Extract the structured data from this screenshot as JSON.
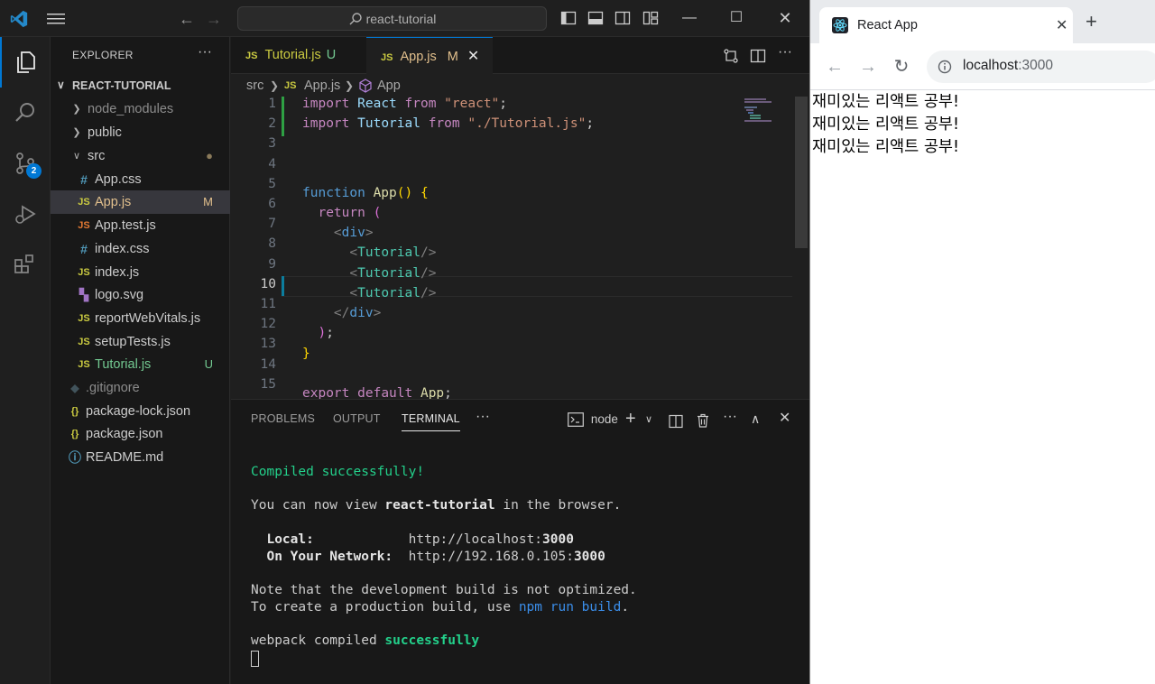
{
  "vscode": {
    "search": {
      "text": "react-tutorial"
    },
    "explorer": {
      "title": "EXPLORER",
      "more": "···",
      "project": "REACT-TUTORIAL",
      "items": [
        {
          "label": "node_modules",
          "kind": "folder",
          "icon": "chevron-right-icon",
          "status": ""
        },
        {
          "label": "public",
          "kind": "folder",
          "icon": "chevron-right-icon",
          "status": ""
        },
        {
          "label": "src",
          "kind": "folder-open",
          "icon": "chevron-down-icon",
          "status": "●"
        },
        {
          "label": "App.css",
          "kind": "file",
          "icon": "#",
          "status": ""
        },
        {
          "label": "App.js",
          "kind": "file",
          "icon": "JS",
          "status": "M"
        },
        {
          "label": "App.test.js",
          "kind": "file",
          "icon": "JS",
          "status": ""
        },
        {
          "label": "index.css",
          "kind": "file",
          "icon": "#",
          "status": ""
        },
        {
          "label": "index.js",
          "kind": "file",
          "icon": "JS",
          "status": ""
        },
        {
          "label": "logo.svg",
          "kind": "file",
          "icon": "svg",
          "status": ""
        },
        {
          "label": "reportWebVitals.js",
          "kind": "file",
          "icon": "JS",
          "status": ""
        },
        {
          "label": "setupTests.js",
          "kind": "file",
          "icon": "JS",
          "status": ""
        },
        {
          "label": "Tutorial.js",
          "kind": "file",
          "icon": "JS",
          "status": "U"
        },
        {
          "label": ".gitignore",
          "kind": "file",
          "icon": "◆",
          "status": ""
        },
        {
          "label": "package-lock.json",
          "kind": "file",
          "icon": "{}",
          "status": ""
        },
        {
          "label": "package.json",
          "kind": "file",
          "icon": "{}",
          "status": ""
        },
        {
          "label": "README.md",
          "kind": "file",
          "icon": "ⓘ",
          "status": ""
        }
      ]
    },
    "source_control_badge": "2",
    "tabs": [
      {
        "icon": "JS",
        "label": "Tutorial.js",
        "status": "U"
      },
      {
        "icon": "JS",
        "label": "App.js",
        "status": "M",
        "close": "✕"
      }
    ],
    "breadcrumb": {
      "root": "src",
      "file_icon": "JS",
      "file": "App.js",
      "symbol": "App"
    },
    "editor": {
      "line_numbers": [
        "1",
        "2",
        "3",
        "4",
        "5",
        "6",
        "7",
        "8",
        "9",
        "10",
        "11",
        "12",
        "13",
        "14",
        "15"
      ],
      "current_line": "10"
    },
    "panel": {
      "tabs": [
        "PROBLEMS",
        "OUTPUT",
        "TERMINAL"
      ],
      "more": "···",
      "terminal_name": "node",
      "terminal": {
        "compiled": "Compiled successfully!",
        "view_prefix": "You can now view ",
        "view_app": "react-tutorial",
        "view_suffix": " in the browser.",
        "local_label": "Local:",
        "local_url_prefix": "http://localhost:",
        "local_port": "3000",
        "network_label": "On Your Network:",
        "network_url_prefix": "http://192.168.0.105:",
        "network_port": "3000",
        "note1": "Note that the development build is not optimized.",
        "note2_prefix": "To create a production build, use ",
        "note2_cmd": "npm run build",
        "note2_suffix": ".",
        "webpack_prefix": "webpack compiled ",
        "webpack_status": "successfully"
      }
    }
  },
  "browser": {
    "tab_title": "React App",
    "tab_close": "✕",
    "new_tab": "+",
    "url_host": "localhost",
    "url_port": ":3000",
    "content_lines": [
      "재미있는 리액트 공부!",
      "재미있는 리액트 공부!",
      "재미있는 리액트 공부!"
    ]
  }
}
